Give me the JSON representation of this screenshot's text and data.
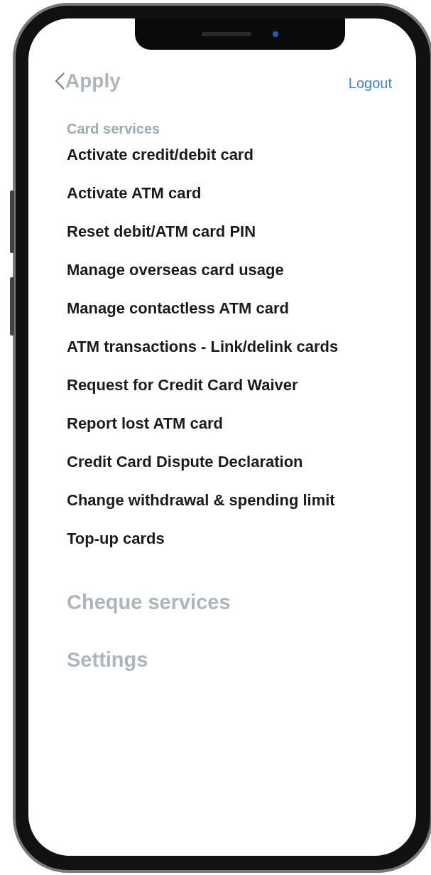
{
  "header": {
    "title": "Apply",
    "title_faded": true,
    "logout": "Logout"
  },
  "sections": [
    {
      "title": "Card services",
      "expanded": true,
      "items": [
        "Activate credit/debit card",
        "Activate ATM card",
        "Reset debit/ATM card PIN",
        "Manage overseas card usage",
        "Manage contactless ATM card",
        "ATM transactions - Link/delink cards",
        "Request for Credit Card Waiver",
        "Report lost ATM card",
        "Credit Card Dispute Declaration",
        "Change withdrawal & spending limit",
        "Top-up cards"
      ]
    },
    {
      "title": "Cheque services",
      "expanded": false
    },
    {
      "title": "Settings",
      "expanded": false
    }
  ]
}
